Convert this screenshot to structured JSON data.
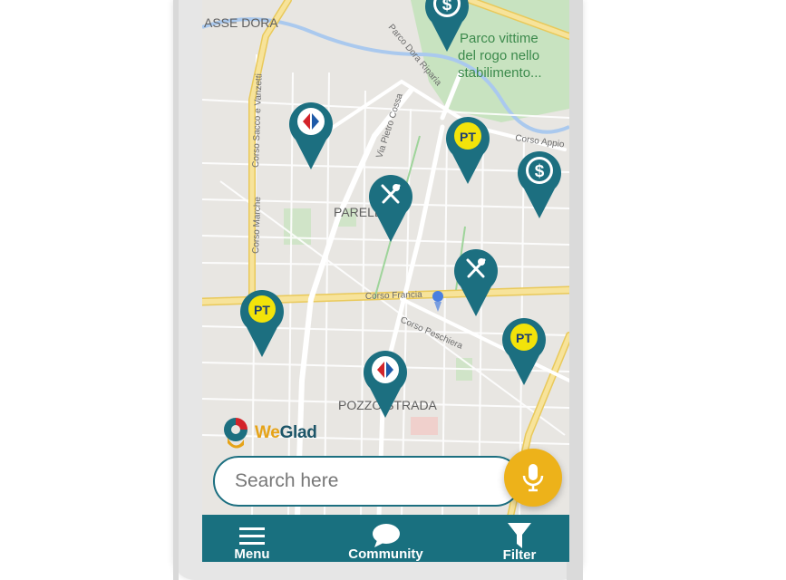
{
  "map": {
    "labels": {
      "district_top": "ASSE DORA",
      "park": [
        "Parco vittime",
        "del rogo nello",
        "stabilimento..."
      ],
      "district_center": "PARELLA",
      "district_bottom": "POZZO STRADA",
      "street_sacco": "Corso Sacco e Vanzetti",
      "street_marche": "Corso Marche",
      "street_costa": "Via Pietro Cossa",
      "street_appio": "Corso Appio",
      "street_francia": "Corso Francia",
      "street_peschiera": "Corso Peschiera",
      "street_dora": "Parco Dora Riparia"
    },
    "markers": [
      {
        "type": "money-icon"
      },
      {
        "type": "carrefour-icon"
      },
      {
        "type": "post-office-icon",
        "label": "PT"
      },
      {
        "type": "money-icon"
      },
      {
        "type": "restaurant-icon"
      },
      {
        "type": "restaurant-icon"
      },
      {
        "type": "post-office-icon",
        "label": "PT"
      },
      {
        "type": "post-office-icon",
        "label": "PT"
      },
      {
        "type": "carrefour-icon"
      }
    ]
  },
  "brand": {
    "we": "We",
    "glad": "Glad"
  },
  "search": {
    "placeholder": "Search here"
  },
  "nav": {
    "menu_label": "Menu",
    "community_label": "Community",
    "filter_label": "Filter"
  },
  "colors": {
    "accent": "#19707f",
    "marker": "#1c6f80",
    "mic": "#edb21a",
    "pt_yellow": "#f2e30a"
  }
}
